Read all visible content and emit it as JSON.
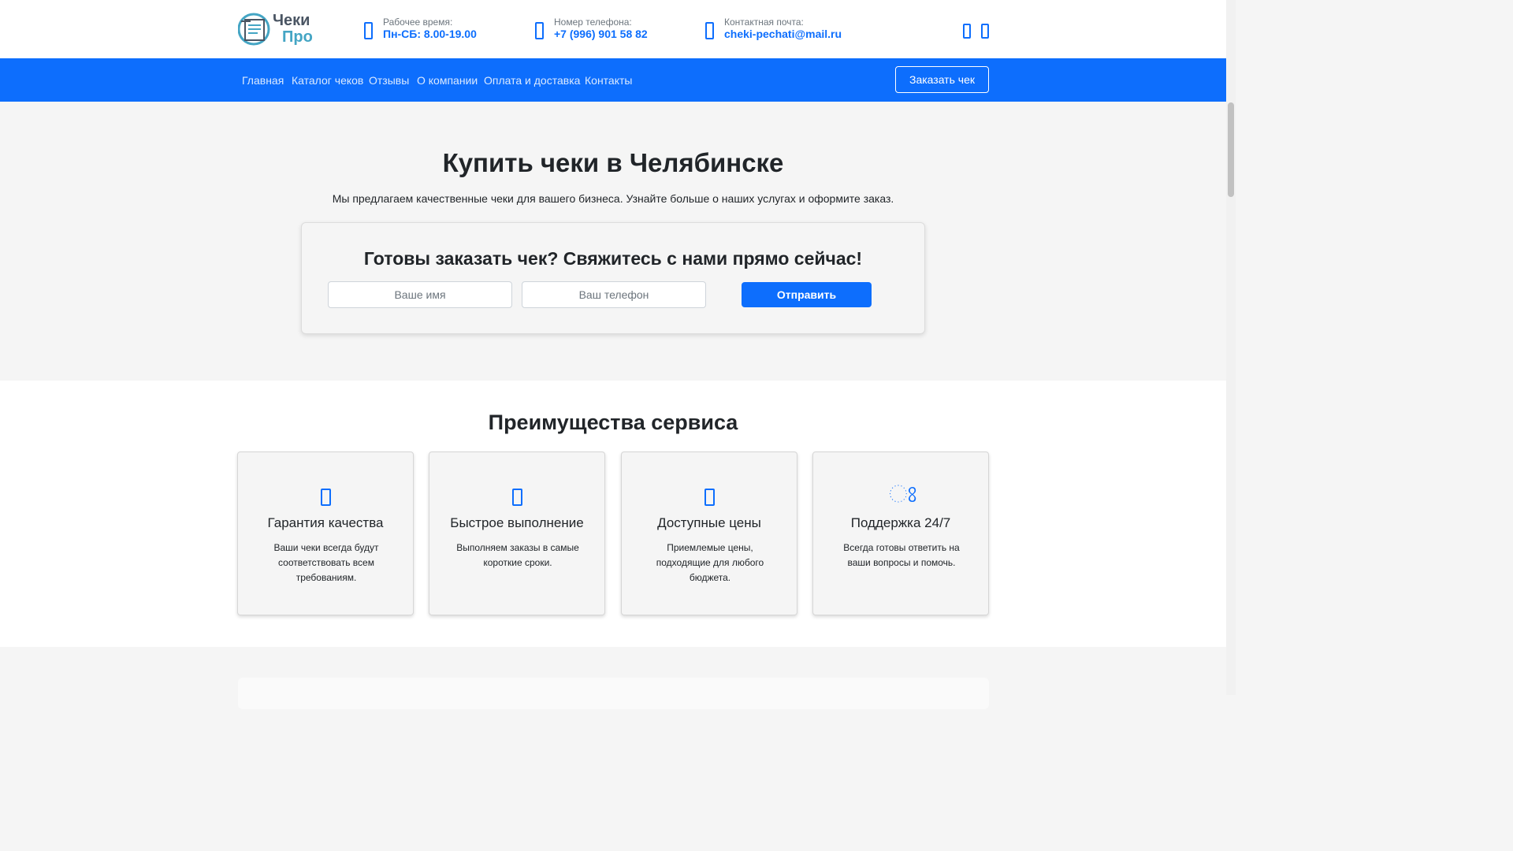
{
  "logo": {
    "line1": "Чеки",
    "line2": "Про"
  },
  "header": {
    "hours": {
      "label": "Рабочее время:",
      "value": "Пн-СБ: 8.00-19.00",
      "icon": "clock-icon"
    },
    "phone": {
      "label": "Номер телефона:",
      "value": "+7 (996) 901 58 82",
      "icon": "phone-icon"
    },
    "email": {
      "label": "Контактная почта:",
      "value": "cheki-pechati@mail.ru",
      "icon": "mail-icon"
    },
    "social": [
      "whatsapp-icon",
      "telegram-icon"
    ]
  },
  "nav": {
    "items": [
      "Главная",
      "Каталог чеков",
      "Отзывы",
      "О компании",
      "Оплата и доставка",
      "Контакты"
    ],
    "order_button": "Заказать чек"
  },
  "hero": {
    "title": "Купить чеки в Челябинске",
    "subtitle": "Мы предлагаем качественные чеки для вашего бизнеса. Узнайте больше о наших услугах и оформите заказ."
  },
  "order_form": {
    "title": "Готовы заказать чек? Свяжитесь с нами прямо сейчас!",
    "name_placeholder": "Ваше имя",
    "phone_placeholder": "Ваш телефон",
    "submit": "Отправить"
  },
  "advantages": {
    "title": "Преимущества сервиса",
    "cards": [
      {
        "icon": "shield-icon",
        "title": "Гарантия качества",
        "text": "Ваши чеки всегда будут соответствовать всем требованиям."
      },
      {
        "icon": "bolt-icon",
        "title": "Быстрое выполнение",
        "text": "Выполняем заказы в самые короткие сроки."
      },
      {
        "icon": "wallet-icon",
        "title": "Доступные цены",
        "text": "Приемлемые цены, подходящие для любого бюджета."
      },
      {
        "icon": "headset-icon",
        "title": "Поддержка 24/7",
        "text": "Всегда готовы ответить на ваши вопросы и помочь."
      }
    ]
  },
  "colors": {
    "accent": "#0d6efd",
    "logo_dark": "#4a5563",
    "logo_light": "#44a5c4"
  }
}
